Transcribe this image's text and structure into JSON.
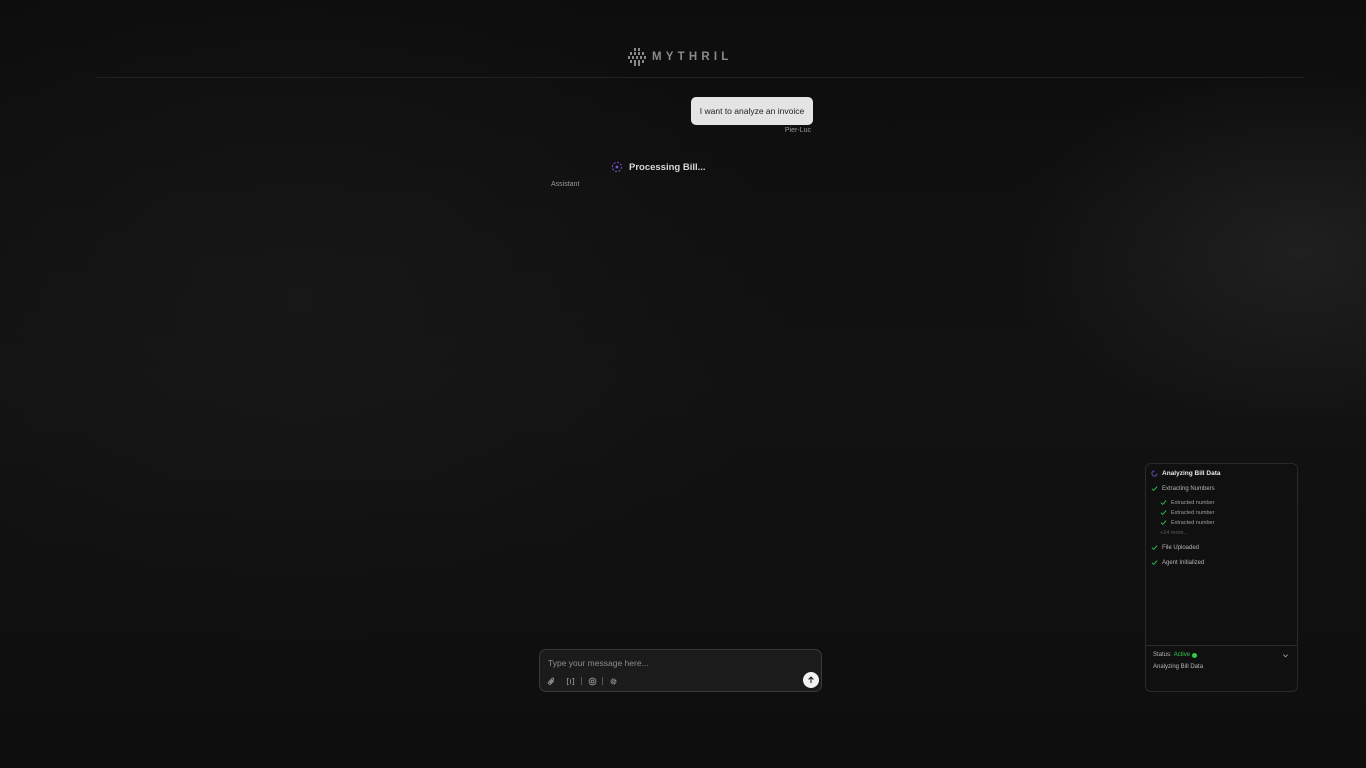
{
  "app": {
    "brand": "MYTHRIL",
    "logo_icon": "mythril-logo-icon"
  },
  "chat": {
    "user_message": "I want to analyze an invoice",
    "user_name": "Pier-Luc",
    "assistant_status": "Processing Bill...",
    "assistant_name": "Assistant"
  },
  "composer": {
    "placeholder": "Type your message here...",
    "tools": [
      "paperclip-icon",
      "brackets-icon",
      "target-icon",
      "gear-icon"
    ],
    "send_icon": "arrow-up-icon"
  },
  "panel": {
    "title": "Analyzing Bill Data",
    "steps": {
      "extract": "Extracting Numbers",
      "sub": [
        "Extracted number",
        "Extracted number",
        "Extracted number"
      ],
      "more": "+14 more...",
      "uploaded": "File Uploaded",
      "initialized": "Agent Initialized"
    },
    "status_label": "Status:",
    "status_value": "Active",
    "current_task": "Analyzing Bill Data"
  },
  "colors": {
    "accent_purple": "#7b4fd6",
    "success_green": "#2ecc4f",
    "background": "#0f0f0f"
  }
}
